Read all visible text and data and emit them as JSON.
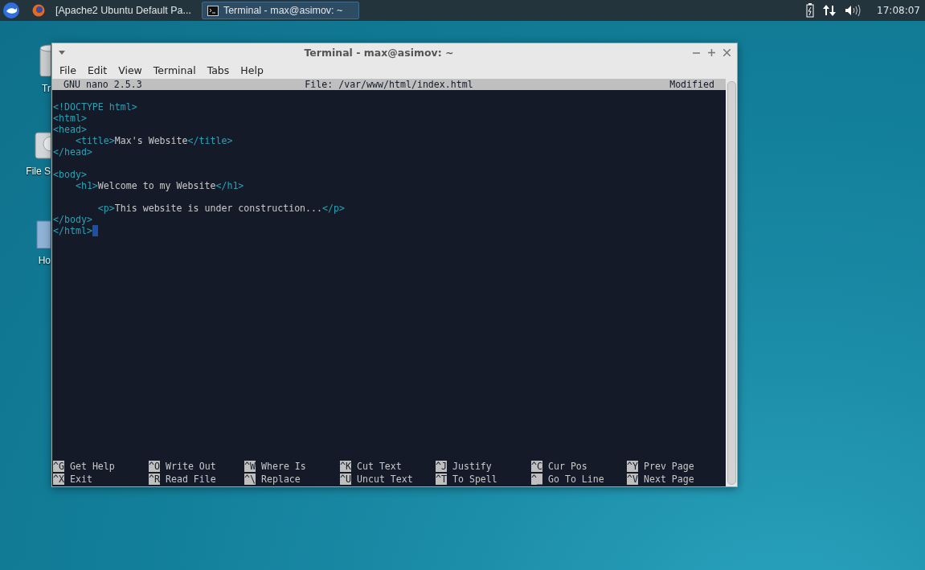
{
  "taskbar": {
    "tasks": [
      {
        "label": "[Apache2 Ubuntu Default Pa...",
        "selected": false
      },
      {
        "label": "Terminal - max@asimov: ~",
        "selected": true
      }
    ],
    "clock": "17:08:07"
  },
  "desktop_icons": [
    {
      "label": "Tr",
      "kind": "trash"
    },
    {
      "label": "File S",
      "kind": "drive"
    },
    {
      "label": "Ho",
      "kind": "folder"
    }
  ],
  "window": {
    "title": "Terminal - max@asimov: ~",
    "menu": [
      "File",
      "Edit",
      "View",
      "Terminal",
      "Tabs",
      "Help"
    ]
  },
  "nano": {
    "version": "GNU nano 2.5.3",
    "file": "File: /var/www/html/index.html",
    "status": "Modified",
    "lines": [
      {
        "kind": "blank"
      },
      {
        "kind": "code",
        "cursor": false,
        "segments": [
          {
            "kind": "tag",
            "text": "<!DOCTYPE html>"
          }
        ]
      },
      {
        "kind": "code",
        "cursor": false,
        "segments": [
          {
            "kind": "tag",
            "text": "<html>"
          }
        ]
      },
      {
        "kind": "code",
        "cursor": false,
        "segments": [
          {
            "kind": "tag",
            "text": "<head>"
          }
        ]
      },
      {
        "kind": "code",
        "cursor": false,
        "segments": [
          {
            "kind": "tag",
            "text": "    <title>"
          },
          {
            "kind": "text",
            "text": "Max's Website"
          },
          {
            "kind": "tag",
            "text": "</title>"
          }
        ]
      },
      {
        "kind": "code",
        "cursor": false,
        "segments": [
          {
            "kind": "tag",
            "text": "</head>"
          }
        ]
      },
      {
        "kind": "blank"
      },
      {
        "kind": "code",
        "cursor": false,
        "segments": [
          {
            "kind": "tag",
            "text": "<body>"
          }
        ]
      },
      {
        "kind": "code",
        "cursor": false,
        "segments": [
          {
            "kind": "tag",
            "text": "    <h1>"
          },
          {
            "kind": "text",
            "text": "Welcome to my Website"
          },
          {
            "kind": "tag",
            "text": "</h1>"
          }
        ]
      },
      {
        "kind": "blank"
      },
      {
        "kind": "code",
        "cursor": false,
        "segments": [
          {
            "kind": "tag",
            "text": "        <p>"
          },
          {
            "kind": "text",
            "text": "This website is under construction..."
          },
          {
            "kind": "tag",
            "text": "</p>"
          }
        ]
      },
      {
        "kind": "code",
        "cursor": false,
        "segments": [
          {
            "kind": "tag",
            "text": "</body>"
          }
        ]
      },
      {
        "kind": "code",
        "cursor": true,
        "segments": [
          {
            "kind": "tag",
            "text": "</html>"
          }
        ]
      }
    ],
    "shortcuts": [
      [
        {
          "key": "^G",
          "label": "Get Help"
        },
        {
          "key": "^O",
          "label": "Write Out"
        },
        {
          "key": "^W",
          "label": "Where Is"
        },
        {
          "key": "^K",
          "label": "Cut Text"
        },
        {
          "key": "^J",
          "label": "Justify"
        },
        {
          "key": "^C",
          "label": "Cur Pos"
        },
        {
          "key": "^Y",
          "label": "Prev Page"
        }
      ],
      [
        {
          "key": "^X",
          "label": "Exit"
        },
        {
          "key": "^R",
          "label": "Read File"
        },
        {
          "key": "^\\",
          "label": "Replace"
        },
        {
          "key": "^U",
          "label": "Uncut Text"
        },
        {
          "key": "^T",
          "label": "To Spell"
        },
        {
          "key": "^_",
          "label": "Go To Line"
        },
        {
          "key": "^V",
          "label": "Next Page"
        }
      ]
    ]
  }
}
